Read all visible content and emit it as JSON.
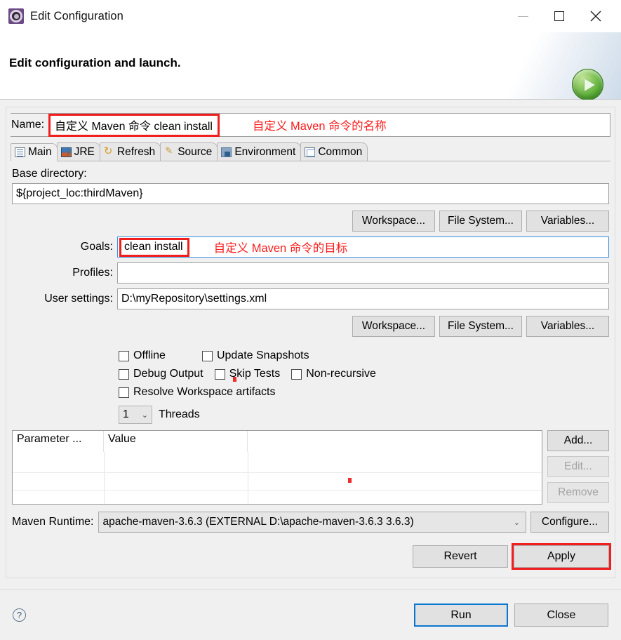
{
  "window": {
    "title": "Edit Configuration",
    "icon": "gear-icon",
    "controls": {
      "minimize": "–",
      "maximize": "☐",
      "close": "✕"
    }
  },
  "banner": {
    "title": "Edit configuration and launch.",
    "run_icon": "run-play-icon"
  },
  "name_row": {
    "label": "Name:",
    "value": "自定义 Maven 命令 clean install",
    "annotation": "自定义 Maven 命令的名称",
    "highlight_color": "#f01e1e"
  },
  "tabs": [
    {
      "label": "Main",
      "icon": "main-tab-icon",
      "active": true
    },
    {
      "label": "JRE",
      "icon": "jre-tab-icon",
      "active": false
    },
    {
      "label": "Refresh",
      "icon": "refresh-tab-icon",
      "active": false
    },
    {
      "label": "Source",
      "icon": "source-tab-icon",
      "active": false
    },
    {
      "label": "Environment",
      "icon": "environment-tab-icon",
      "active": false
    },
    {
      "label": "Common",
      "icon": "common-tab-icon",
      "active": false
    }
  ],
  "main": {
    "base_directory_label": "Base directory:",
    "base_directory_value": "${project_loc:thirdMaven}",
    "browse_buttons": [
      "Workspace...",
      "File System...",
      "Variables..."
    ],
    "goals_label": "Goals:",
    "goals_value": "clean install",
    "goals_annotation": "自定义 Maven 命令的目标",
    "profiles_label": "Profiles:",
    "profiles_value": "",
    "user_settings_label": "User settings:",
    "user_settings_value": "D:\\myRepository\\settings.xml",
    "settings_buttons": [
      "Workspace...",
      "File System...",
      "Variables..."
    ],
    "checkboxes": [
      {
        "label": "Offline",
        "checked": false
      },
      {
        "label": "Update Snapshots",
        "checked": false
      },
      {
        "label": "Debug Output",
        "checked": false
      },
      {
        "label": "Skip Tests",
        "checked": false
      },
      {
        "label": "Non-recursive",
        "checked": false
      },
      {
        "label": "Resolve Workspace artifacts",
        "checked": false
      }
    ],
    "threads_value": "1",
    "threads_label": "Threads",
    "table": {
      "columns": [
        "Parameter ...",
        "Value"
      ],
      "rows": []
    },
    "table_buttons": [
      {
        "label": "Add...",
        "enabled": true
      },
      {
        "label": "Edit...",
        "enabled": false
      },
      {
        "label": "Remove",
        "enabled": false
      }
    ],
    "runtime_label": "Maven Runtime:",
    "runtime_value": "apache-maven-3.6.3 (EXTERNAL D:\\apache-maven-3.6.3 3.6.3)",
    "configure_button": "Configure..."
  },
  "apply_row": {
    "revert": "Revert",
    "apply": "Apply"
  },
  "footer": {
    "help_icon": "help-icon",
    "run": "Run",
    "close": "Close"
  }
}
